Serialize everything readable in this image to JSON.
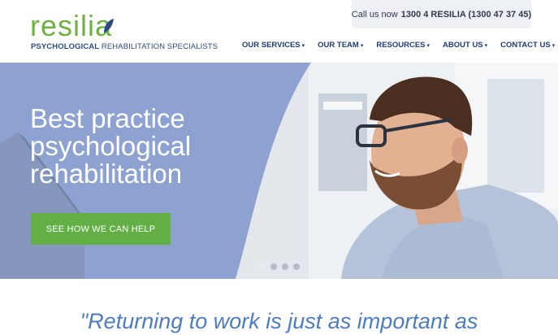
{
  "logo": {
    "wordmark": "resilia",
    "tagline_bold": "PSYCHOLOGICAL",
    "tagline_rest": " REHABILITATION SPECIALISTS"
  },
  "contact": {
    "prefix": "Call us now",
    "number": "1300 4 RESILIA (1300 47 37 45)"
  },
  "nav": {
    "items": [
      {
        "label": "OUR SERVICES"
      },
      {
        "label": "OUR TEAM"
      },
      {
        "label": "RESOURCES"
      },
      {
        "label": "ABOUT US"
      },
      {
        "label": "CONTACT US"
      }
    ]
  },
  "hero": {
    "title_lines": [
      "Best practice",
      "psychological",
      "rehabilitation"
    ],
    "cta_label": "SEE HOW WE CAN HELP",
    "slide_count": 4,
    "active_slide": 1
  },
  "quote": {
    "text": "\"Returning to work is just as important as"
  },
  "colors": {
    "brand_green": "#6cb33f",
    "brand_navy": "#1f3c78",
    "hero_blue": "#8ea2d2",
    "cta_green": "#62b045",
    "quote_blue": "#4d7cc1"
  }
}
